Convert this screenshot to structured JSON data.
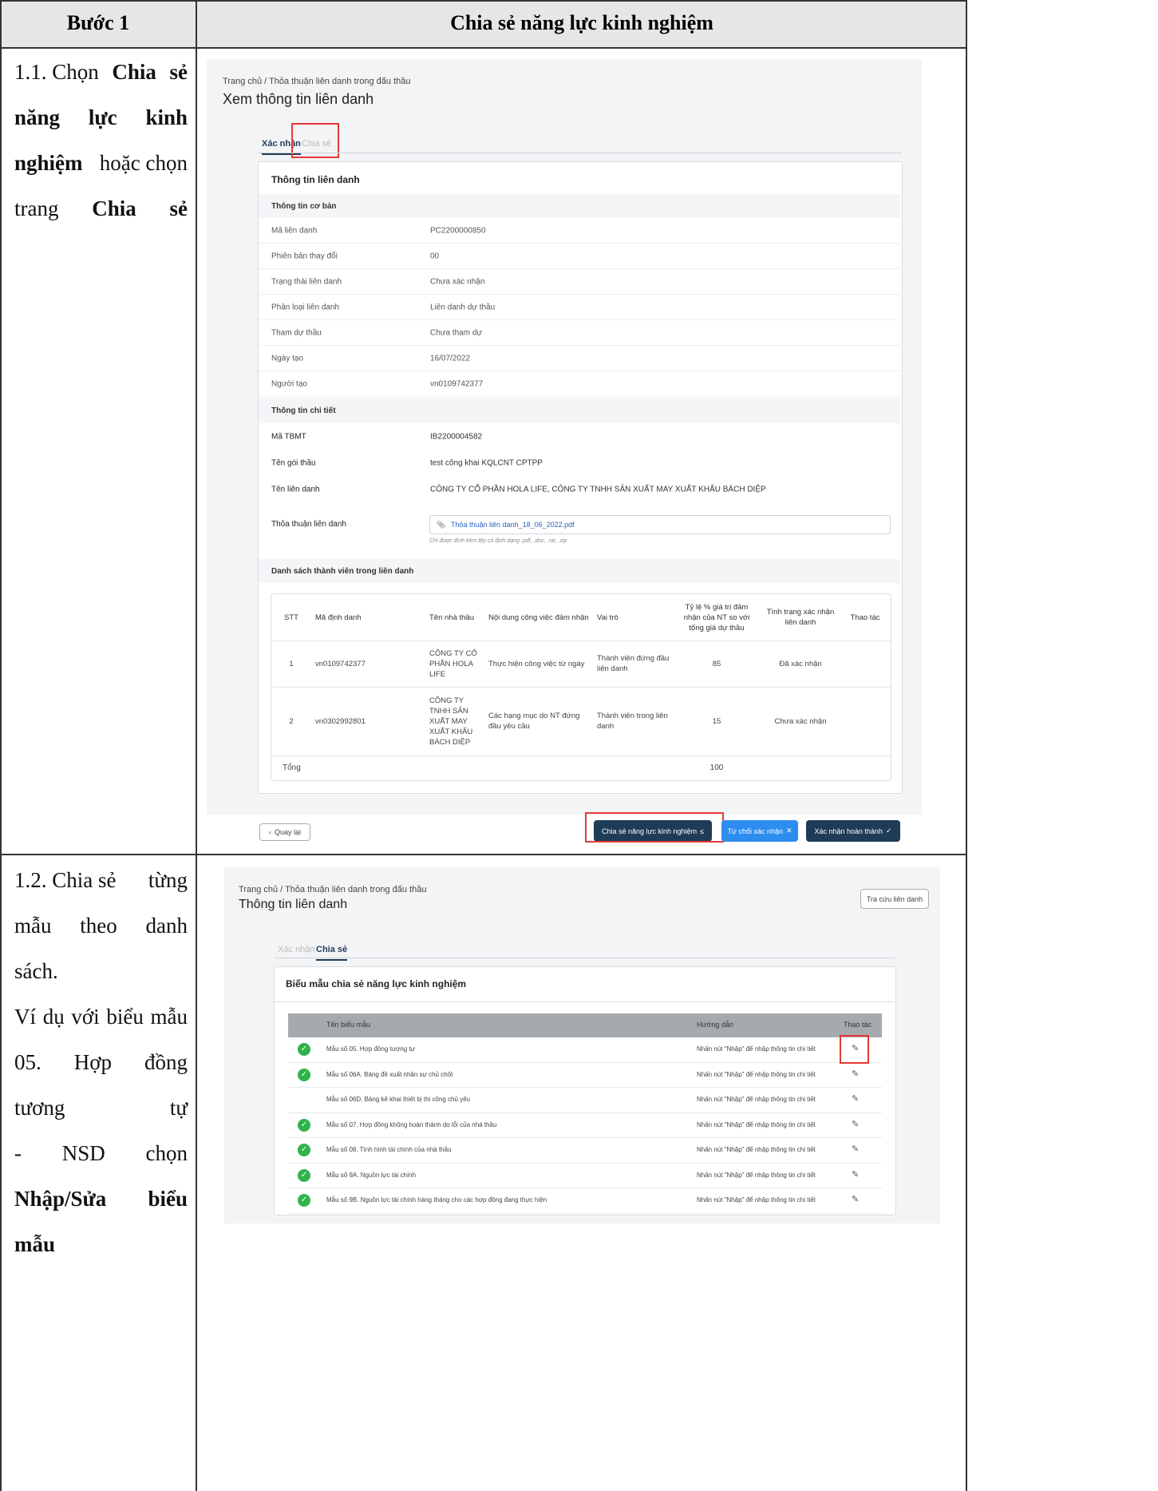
{
  "header": {
    "col1": "Bước 1",
    "col2": "Chia sẻ năng lực kinh nghiệm"
  },
  "step1": {
    "num": "1.1. Chọn",
    "w1": "Chia",
    "w2": "sẻ",
    "w3": "năng",
    "w4": "lực",
    "w5": "kinh",
    "w6": "nghiệm",
    "w7": "hoặc chọn",
    "w8": "trang",
    "w9": "Chia sẻ"
  },
  "step2": {
    "l1a": "1.2. Chia sẻ",
    "l1b": "từng",
    "l2a": "mẫu",
    "l2b": "theo",
    "l2c": "danh",
    "l3": "sách.",
    "l4": "Ví dụ với biểu mẫu",
    "l5a": "05.",
    "l5b": "Hợp",
    "l5c": "đồng",
    "l6": "tương tự",
    "l7a": "-",
    "l7b": "NSD",
    "l7c": "chọn",
    "l8a": "Nhập/Sửa",
    "l8b": "biểu",
    "l9": "mẫu"
  },
  "screen1": {
    "breadcrumb": "Trang chủ  /  Thỏa thuận liên danh trong đấu thầu",
    "title": "Xem thông tin liên danh",
    "tab_confirm": "Xác nhận",
    "tab_share": "Chia sẻ",
    "card_title": "Thông tin liên danh",
    "sect_basic": "Thông tin cơ bản",
    "basic": [
      {
        "k": "Mã liên danh",
        "v": "PC2200000850"
      },
      {
        "k": "Phiên bản thay đổi",
        "v": "00"
      },
      {
        "k": "Trạng thái liên danh",
        "v": "Chưa xác nhận"
      },
      {
        "k": "Phân loại liên danh",
        "v": "Liên danh dự thầu"
      },
      {
        "k": "Tham dự thầu",
        "v": "Chưa tham dự"
      },
      {
        "k": "Ngày tạo",
        "v": "16/07/2022"
      },
      {
        "k": "Người tạo",
        "v": "vn0109742377"
      }
    ],
    "sect_detail": "Thông tin chi tiết",
    "detail": [
      {
        "k": "Mã TBMT",
        "v": "IB2200004582"
      },
      {
        "k": "Tên gói thầu",
        "v": "test công khai KQLCNT CPTPP"
      },
      {
        "k": "Tên liên danh",
        "v": "CÔNG TY CỔ PHẦN HOLA LIFE, CÔNG TY TNHH SẢN XUẤT MAY XUẤT KHẨU BÁCH DIỆP"
      }
    ],
    "agreement_label": "Thỏa thuận liên danh",
    "agreement_file": "Thỏa thuận liên danh_18_06_2022.pdf",
    "agreement_hint": "Chỉ được đính kèm tệp có định dạng .pdf, .doc, .rar, .zip",
    "sect_members": "Danh sách thành viên trong liên danh",
    "members_head": {
      "stt": "STT",
      "id": "Mã định danh",
      "name": "Tên nhà thầu",
      "work": "Nội dung công việc đảm nhận",
      "role": "Vai trò",
      "ratio": "Tỷ lệ % giá trị đảm nhận của NT so với tổng giá dự thầu",
      "status": "Tình trạng xác nhận liên danh",
      "action": "Thao tác"
    },
    "members": [
      {
        "stt": "1",
        "id": "vn0109742377",
        "name": "CÔNG TY CỔ PHẦN HOLA LIFE",
        "work": "Thực hiện công việc từ ngày",
        "role": "Thành viên đứng đầu liên danh",
        "ratio": "85",
        "status": "Đã xác nhận"
      },
      {
        "stt": "2",
        "id": "vn0302992801",
        "name": "CÔNG TY TNHH SẢN XUẤT MAY XUẤT KHẨU BÁCH DIỆP",
        "work": "Các hạng mục do NT đứng đầu yêu cầu",
        "role": "Thành viên trong liên danh",
        "ratio": "15",
        "status": "Chưa xác nhận"
      }
    ],
    "total_label": "Tổng",
    "total_value": "100",
    "btn_back": "Quay lại",
    "btn_share": "Chia sẻ năng lực kinh nghiệm",
    "btn_reject": "Từ chối xác nhận",
    "btn_done": "Xác nhận hoàn thành"
  },
  "screen2": {
    "breadcrumb": "Trang chủ  /  Thỏa thuận liên danh trong đấu thầu",
    "title": "Thông tin liên danh",
    "btn_lookup": "Tra cứu liên danh",
    "tab_confirm": "Xác nhận",
    "tab_share": "Chia sẻ",
    "card_title": "Biểu mẫu chia sẻ năng lực kinh nghiệm",
    "head": {
      "name": "Tên biểu mẫu",
      "guide": "Hướng dẫn",
      "action": "Thao tác"
    },
    "forms": [
      {
        "name": "Mẫu số 05. Hợp đồng tương tự",
        "guide": "Nhấn nút \"Nhập\" để nhập thông tin chi tiết",
        "done": true
      },
      {
        "name": "Mẫu số 06A. Bảng đề xuất nhân sự chủ chốt",
        "guide": "Nhấn nút \"Nhập\" để nhập thông tin chi tiết",
        "done": true
      },
      {
        "name": "Mẫu số 06D. Bảng kê khai thiết bị thi công chủ yếu",
        "guide": "Nhấn nút \"Nhập\" để nhập thông tin chi tiết",
        "done": false
      },
      {
        "name": "Mẫu số 07. Hợp đồng không hoàn thành do lỗi của nhà thầu",
        "guide": "Nhấn nút \"Nhập\" để nhập thông tin chi tiết",
        "done": true
      },
      {
        "name": "Mẫu số 08. Tình hình tài chính của nhà thầu",
        "guide": "Nhấn nút \"Nhập\" để nhập thông tin chi tiết",
        "done": true
      },
      {
        "name": "Mẫu số 9A. Nguồn lực tài chính",
        "guide": "Nhấn nút \"Nhập\" để nhập thông tin chi tiết",
        "done": true
      },
      {
        "name": "Mẫu số 9B. Nguồn lực tài chính hàng tháng cho các hợp đồng đang thực hiện",
        "guide": "Nhấn nút \"Nhập\" để nhập thông tin chi tiết",
        "done": true
      }
    ]
  }
}
